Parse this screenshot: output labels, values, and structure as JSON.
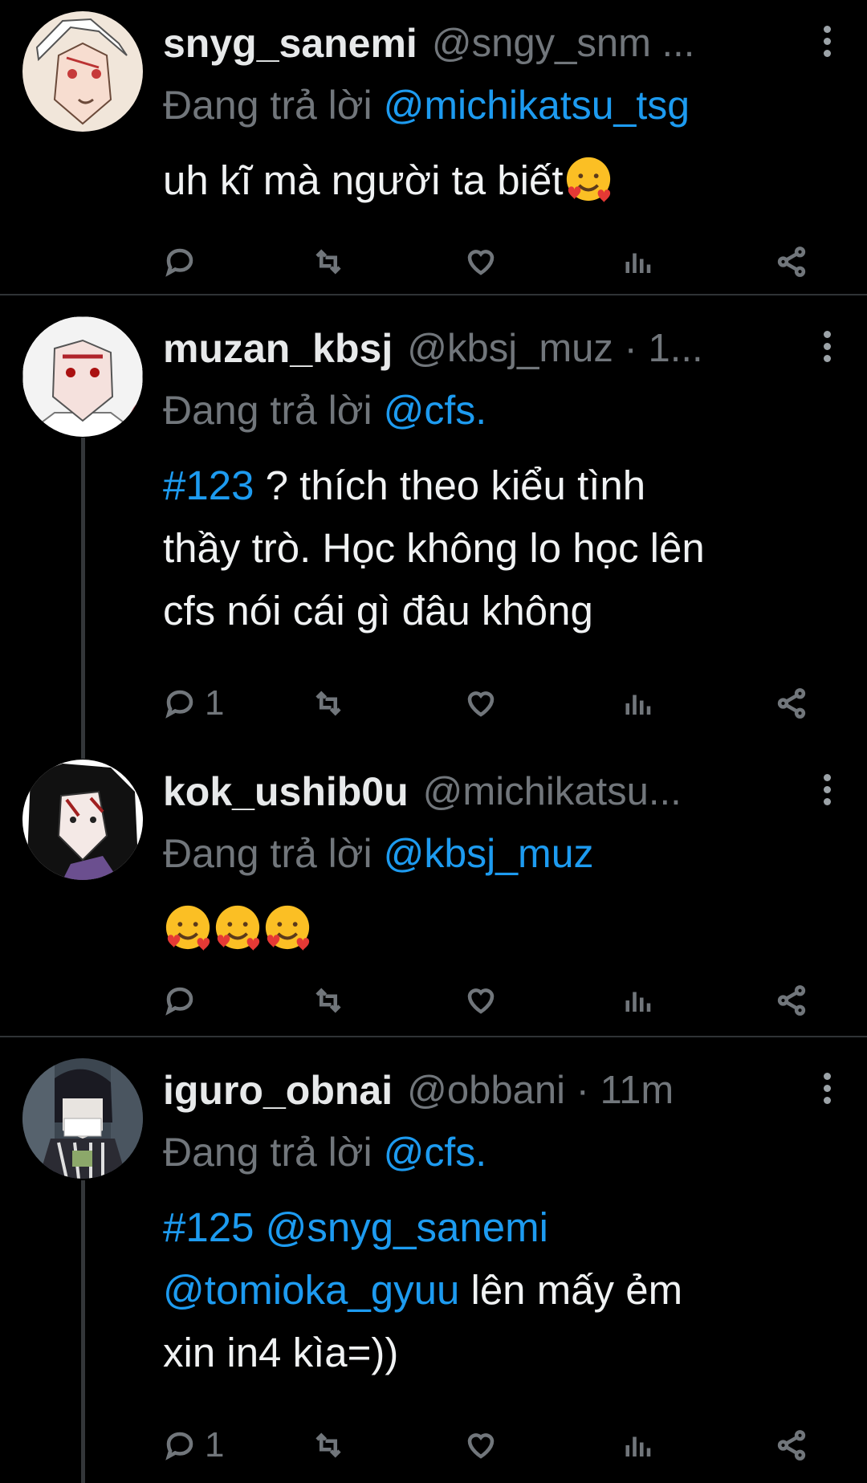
{
  "colors": {
    "background": "#000000",
    "link": "#1d9bf0",
    "muted": "#71767b",
    "text": "#e7e9ea",
    "divider": "#2f3336"
  },
  "tweets": [
    {
      "name": "snyg_sanemi",
      "handle": "@sngy_snm ...",
      "replying_prefix": "Đang trả lời",
      "replying_to": "@michikatsu_tsg",
      "text": "uh kĩ mà người ta biết",
      "emoji": [
        "smiling-face-with-hearts"
      ],
      "reply_count": ""
    },
    {
      "name": "muzan_kbsj",
      "handle": "@kbsj_muz · 1...",
      "replying_prefix": "Đang trả lời",
      "replying_to": "@cfs.",
      "hashtag": "#123",
      "text_line1": " ? thích theo kiểu tình",
      "text_line2": "thầy trò. Học không lo học lên",
      "text_line3": "cfs nói cái gì đâu không",
      "reply_count": "1"
    },
    {
      "name": "kok_ushib0u",
      "handle": "@michikatsu...",
      "replying_prefix": "Đang trả lời",
      "replying_to": "@kbsj_muz",
      "emoji": [
        "smiling-face-with-hearts",
        "smiling-face-with-hearts",
        "smiling-face-with-hearts"
      ],
      "reply_count": ""
    },
    {
      "name": "iguro_obnai",
      "handle": "@obbani · 11m",
      "replying_prefix": "Đang trả lời",
      "replying_to": "@cfs.",
      "hashtag": "#125",
      "mention1": "@snyg_sanemi",
      "mention2": "@tomioka_gyuu",
      "text_line2": " lên mấy ẻm",
      "text_line3": "xin in4 kìa=))",
      "reply_count": "1"
    }
  ]
}
